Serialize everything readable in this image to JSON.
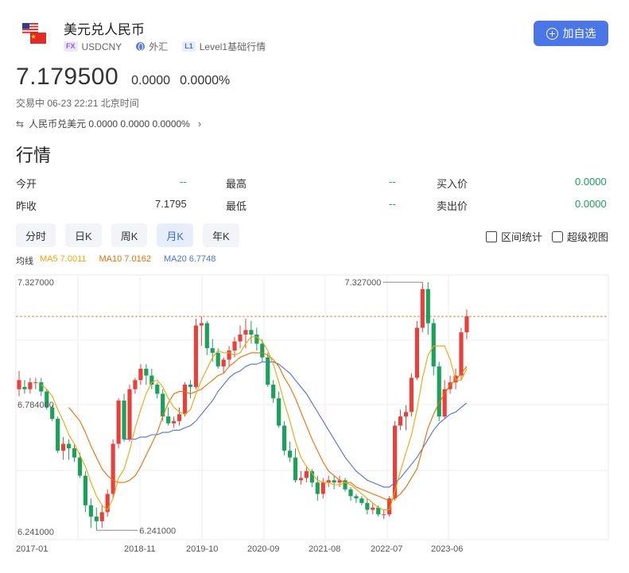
{
  "header": {
    "title": "美元兑人民币",
    "badge_fx": "FX",
    "symbol": "USDCNY",
    "market": "外汇",
    "badge_l1": "L1",
    "level": "Level1基础行情",
    "watch_label": "加自选"
  },
  "quote": {
    "price": "7.179500",
    "change": "0.0000",
    "change_pct": "0.0000%",
    "status": "交易中 06-23 22:21 北京时间",
    "cross": "人民币兑美元 0.0000 0.0000 0.0000%"
  },
  "section_title": "行情",
  "stats": {
    "open_label": "今开",
    "open": "--",
    "high_label": "最高",
    "high": "--",
    "bid_label": "买入价",
    "bid": "0.0000",
    "prev_label": "昨收",
    "prev": "7.1795",
    "low_label": "最低",
    "low": "--",
    "ask_label": "卖出价",
    "ask": "0.0000"
  },
  "tabs": [
    "分时",
    "日K",
    "周K",
    "月K",
    "年K"
  ],
  "active_tab": 3,
  "tools": {
    "range_stats": "区间统计",
    "super_view": "超级视图"
  },
  "ma_legend": {
    "label": "均线",
    "ma5": "MA5 7.0011",
    "ma10": "MA10 7.0162",
    "ma20": "MA20 6.7748"
  },
  "colors": {
    "up": "#e8413b",
    "down": "#1aa15a",
    "ma5": "#f0a500",
    "ma10": "#ef6c00",
    "ma20": "#4a72e0",
    "accent": "#4a76e8",
    "ref_line": "#e8892b"
  },
  "chart_data": {
    "type": "candlestick",
    "y_ticks": [
      "7.327000",
      "6.784000",
      "6.241000"
    ],
    "x_ticks": [
      "2017-01",
      "2018-11",
      "2019-10",
      "2020-09",
      "2021-08",
      "2022-07",
      "2023-06"
    ],
    "max_label": "7.327000",
    "min_label": "6.241000",
    "ylim": [
      6.241,
      7.327
    ],
    "ref_line": 7.18,
    "candles": [
      [
        6.86,
        6.9,
        6.83,
        6.94
      ],
      [
        6.87,
        6.86,
        6.84,
        6.9
      ],
      [
        6.86,
        6.89,
        6.84,
        6.91
      ],
      [
        6.89,
        6.89,
        6.86,
        6.91
      ],
      [
        6.89,
        6.85,
        6.83,
        6.91
      ],
      [
        6.85,
        6.78,
        6.77,
        6.86
      ],
      [
        6.78,
        6.73,
        6.72,
        6.79
      ],
      [
        6.73,
        6.59,
        6.58,
        6.74
      ],
      [
        6.59,
        6.62,
        6.55,
        6.65
      ],
      [
        6.62,
        6.6,
        6.55,
        6.64
      ],
      [
        6.6,
        6.56,
        6.54,
        6.62
      ],
      [
        6.56,
        6.48,
        6.47,
        6.58
      ],
      [
        6.48,
        6.35,
        6.32,
        6.5
      ],
      [
        6.35,
        6.3,
        6.25,
        6.38
      ],
      [
        6.3,
        6.28,
        6.24,
        6.34
      ],
      [
        6.28,
        6.32,
        6.25,
        6.35
      ],
      [
        6.32,
        6.4,
        6.3,
        6.42
      ],
      [
        6.4,
        6.62,
        6.38,
        6.64
      ],
      [
        6.62,
        6.81,
        6.6,
        6.82
      ],
      [
        6.81,
        6.64,
        6.63,
        6.84
      ],
      [
        6.64,
        6.86,
        6.63,
        6.88
      ],
      [
        6.86,
        6.9,
        6.84,
        6.91
      ],
      [
        6.9,
        6.95,
        6.88,
        6.97
      ],
      [
        6.95,
        6.92,
        6.88,
        6.97
      ],
      [
        6.92,
        6.88,
        6.86,
        6.95
      ],
      [
        6.88,
        6.84,
        6.82,
        6.89
      ],
      [
        6.84,
        6.74,
        6.72,
        6.86
      ],
      [
        6.74,
        6.71,
        6.7,
        6.78
      ],
      [
        6.71,
        6.72,
        6.69,
        6.74
      ],
      [
        6.72,
        6.75,
        6.7,
        6.78
      ],
      [
        6.75,
        6.88,
        6.74,
        6.89
      ],
      [
        6.88,
        6.87,
        6.82,
        6.9
      ],
      [
        6.87,
        7.14,
        6.86,
        7.17
      ],
      [
        7.14,
        7.15,
        7.05,
        7.18
      ],
      [
        7.15,
        7.04,
        7.01,
        7.16
      ],
      [
        7.04,
        7.02,
        6.98,
        7.08
      ],
      [
        7.02,
        6.96,
        6.95,
        7.04
      ],
      [
        6.96,
        6.99,
        6.93,
        7.0
      ],
      [
        6.99,
        7.03,
        6.96,
        7.05
      ],
      [
        7.03,
        7.07,
        7.0,
        7.09
      ],
      [
        7.07,
        7.1,
        7.04,
        7.14
      ],
      [
        7.1,
        7.12,
        7.04,
        7.17
      ],
      [
        7.12,
        7.1,
        7.06,
        7.16
      ],
      [
        7.1,
        7.06,
        7.03,
        7.13
      ],
      [
        7.06,
        7.0,
        6.98,
        7.08
      ],
      [
        7.0,
        6.88,
        6.87,
        7.02
      ],
      [
        6.88,
        6.82,
        6.8,
        6.9
      ],
      [
        6.82,
        6.7,
        6.69,
        6.85
      ],
      [
        6.7,
        6.59,
        6.57,
        6.72
      ],
      [
        6.59,
        6.56,
        6.54,
        6.63
      ],
      [
        6.56,
        6.46,
        6.45,
        6.6
      ],
      [
        6.46,
        6.47,
        6.44,
        6.5
      ],
      [
        6.47,
        6.5,
        6.45,
        6.52
      ],
      [
        6.5,
        6.45,
        6.43,
        6.51
      ],
      [
        6.45,
        6.4,
        6.37,
        6.48
      ],
      [
        6.4,
        6.45,
        6.38,
        6.47
      ],
      [
        6.45,
        6.46,
        6.43,
        6.48
      ],
      [
        6.46,
        6.45,
        6.42,
        6.48
      ],
      [
        6.45,
        6.46,
        6.43,
        6.48
      ],
      [
        6.46,
        6.42,
        6.41,
        6.47
      ],
      [
        6.42,
        6.39,
        6.37,
        6.43
      ],
      [
        6.39,
        6.38,
        6.36,
        6.4
      ],
      [
        6.38,
        6.36,
        6.35,
        6.39
      ],
      [
        6.36,
        6.33,
        6.31,
        6.38
      ],
      [
        6.33,
        6.34,
        6.31,
        6.36
      ],
      [
        6.34,
        6.31,
        6.3,
        6.35
      ],
      [
        6.31,
        6.31,
        6.29,
        6.33
      ],
      [
        6.31,
        6.38,
        6.3,
        6.39
      ],
      [
        6.38,
        6.7,
        6.37,
        6.72
      ],
      [
        6.7,
        6.74,
        6.68,
        6.77
      ],
      [
        6.74,
        6.76,
        6.68,
        6.79
      ],
      [
        6.76,
        6.91,
        6.74,
        6.93
      ],
      [
        6.91,
        7.13,
        6.9,
        7.16
      ],
      [
        7.13,
        7.3,
        7.11,
        7.33
      ],
      [
        7.3,
        7.15,
        7.1,
        7.33
      ],
      [
        7.15,
        6.96,
        6.92,
        7.17
      ],
      [
        6.96,
        6.74,
        6.72,
        6.98
      ],
      [
        6.74,
        6.86,
        6.73,
        6.9
      ],
      [
        6.86,
        6.89,
        6.84,
        6.92
      ],
      [
        6.89,
        6.92,
        6.86,
        6.95
      ],
      [
        6.92,
        7.11,
        6.9,
        7.13
      ],
      [
        7.11,
        7.18,
        7.08,
        7.21
      ]
    ],
    "ma5": [
      null,
      null,
      null,
      null,
      6.88,
      6.86,
      6.83,
      6.77,
      6.72,
      6.66,
      6.62,
      6.57,
      6.52,
      6.45,
      6.39,
      6.35,
      6.33,
      6.38,
      6.47,
      6.51,
      6.59,
      6.69,
      6.77,
      6.84,
      6.89,
      6.9,
      6.87,
      6.82,
      6.78,
      6.76,
      6.75,
      6.77,
      6.84,
      6.9,
      6.95,
      7.0,
      7.03,
      7.02,
      7.02,
      7.01,
      7.02,
      7.06,
      7.09,
      7.09,
      7.07,
      7.03,
      6.97,
      6.89,
      6.8,
      6.72,
      6.63,
      6.56,
      6.52,
      6.49,
      6.46,
      6.45,
      6.45,
      6.44,
      6.44,
      6.45,
      6.44,
      6.42,
      6.4,
      6.38,
      6.36,
      6.34,
      6.33,
      6.33,
      6.41,
      6.5,
      6.58,
      6.66,
      6.77,
      6.91,
      7.01,
      7.05,
      7.05,
      7.05,
      6.99,
      6.9,
      6.9,
      6.95
    ],
    "ma10": [
      null,
      null,
      null,
      null,
      null,
      null,
      null,
      null,
      null,
      6.78,
      6.75,
      6.72,
      6.67,
      6.61,
      6.56,
      6.51,
      6.48,
      6.46,
      6.45,
      6.45,
      6.46,
      6.48,
      6.52,
      6.57,
      6.62,
      6.67,
      6.74,
      6.8,
      6.84,
      6.85,
      6.85,
      6.84,
      6.85,
      6.86,
      6.88,
      6.9,
      6.92,
      6.93,
      6.96,
      6.98,
      7.0,
      7.01,
      7.02,
      7.02,
      7.02,
      7.01,
      6.99,
      6.96,
      6.91,
      6.87,
      6.82,
      6.76,
      6.7,
      6.64,
      6.59,
      6.54,
      6.5,
      6.48,
      6.46,
      6.45,
      6.45,
      6.43,
      6.42,
      6.41,
      6.4,
      6.39,
      6.38,
      6.37,
      6.38,
      6.4,
      6.43,
      6.47,
      6.51,
      6.6,
      6.69,
      6.75,
      6.8,
      6.84,
      6.88,
      6.9,
      6.93,
      6.96
    ],
    "ma20": [
      null,
      null,
      null,
      null,
      null,
      null,
      null,
      null,
      null,
      null,
      null,
      null,
      null,
      null,
      null,
      null,
      null,
      null,
      null,
      6.64,
      6.64,
      6.64,
      6.65,
      6.65,
      6.66,
      6.66,
      6.67,
      6.67,
      6.68,
      6.68,
      6.69,
      6.7,
      6.72,
      6.75,
      6.78,
      6.81,
      6.85,
      6.88,
      6.91,
      6.93,
      6.94,
      6.96,
      6.97,
      6.97,
      6.98,
      6.98,
      6.98,
      6.97,
      6.95,
      6.93,
      6.9,
      6.87,
      6.84,
      6.8,
      6.76,
      6.72,
      6.68,
      6.64,
      6.6,
      6.56,
      6.53,
      6.5,
      6.48,
      6.46,
      6.45,
      6.44,
      6.43,
      6.43,
      6.45,
      6.47,
      6.5,
      6.53,
      6.56,
      6.6,
      6.64,
      6.68,
      6.71,
      6.73,
      6.75,
      6.76,
      6.78,
      6.8
    ]
  }
}
